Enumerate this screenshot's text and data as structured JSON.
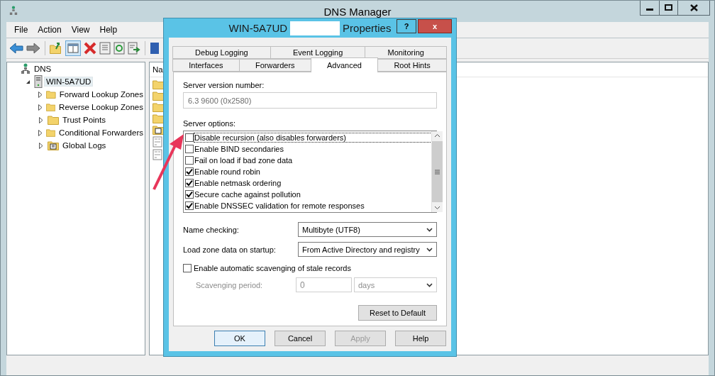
{
  "window": {
    "title": "DNS Manager"
  },
  "menu": [
    "File",
    "Action",
    "View",
    "Help"
  ],
  "tree": [
    {
      "label": "DNS",
      "selected": false,
      "children": [
        {
          "label": "WIN-5A7UD",
          "expanded": true,
          "selected": true,
          "children": [
            {
              "label": "Forward Lookup Zones",
              "expanded": false,
              "selected": false
            },
            {
              "label": "Reverse Lookup Zones",
              "expanded": false,
              "selected": false
            },
            {
              "label": "Trust Points",
              "expanded": false,
              "selected": false
            },
            {
              "label": "Conditional Forwarders",
              "expanded": false,
              "selected": false
            },
            {
              "label": "Global Logs",
              "expanded": false,
              "selected": false
            }
          ]
        }
      ]
    }
  ],
  "list": {
    "column_1": "Na"
  },
  "dialog": {
    "title_start": "WIN-5A7UD",
    "title_end": "Properties",
    "help": "?",
    "close": "x",
    "tabs": [
      [
        {
          "label": "Debug Logging",
          "selected": false
        },
        {
          "label": "Event Logging",
          "selected": false
        },
        {
          "label": "Monitoring",
          "selected": false
        }
      ],
      [
        {
          "label": "Interfaces",
          "selected": false
        },
        {
          "label": "Forwarders",
          "selected": false
        },
        {
          "label": "Advanced",
          "selected": true
        },
        {
          "label": "Root Hints",
          "selected": false
        }
      ]
    ],
    "version_label": "Server version number:",
    "version_value": "6.3 9600 (0x2580)",
    "options_label": "Server options:",
    "options": [
      {
        "label": "Disable recursion (also disables forwarders)",
        "checked": false,
        "focused": true
      },
      {
        "label": "Enable BIND secondaries",
        "checked": false,
        "focused": false
      },
      {
        "label": "Fail on load if bad zone data",
        "checked": false,
        "focused": false
      },
      {
        "label": "Enable round robin",
        "checked": true,
        "focused": false
      },
      {
        "label": "Enable netmask ordering",
        "checked": true,
        "focused": false
      },
      {
        "label": "Secure cache against pollution",
        "checked": true,
        "focused": false
      },
      {
        "label": "Enable DNSSEC validation for remote responses",
        "checked": true,
        "focused": false
      }
    ],
    "selects": [
      {
        "label": "Name checking:",
        "value": "Multibyte (UTF8)"
      },
      {
        "label": "Load zone data on startup:",
        "value": "From Active Directory and registry"
      }
    ],
    "scavenging": {
      "label": "Enable automatic scavenging of stale records",
      "checked": false,
      "period_label": "Scavenging period:",
      "period_value": "0",
      "unit": "days",
      "disabled": true
    },
    "reset": "Reset to Default",
    "buttons": [
      {
        "label": "OK",
        "default": true,
        "disabled": false
      },
      {
        "label": "Cancel",
        "default": false,
        "disabled": false
      },
      {
        "label": "Apply",
        "default": false,
        "disabled": true
      },
      {
        "label": "Help",
        "default": false,
        "disabled": false
      }
    ]
  }
}
